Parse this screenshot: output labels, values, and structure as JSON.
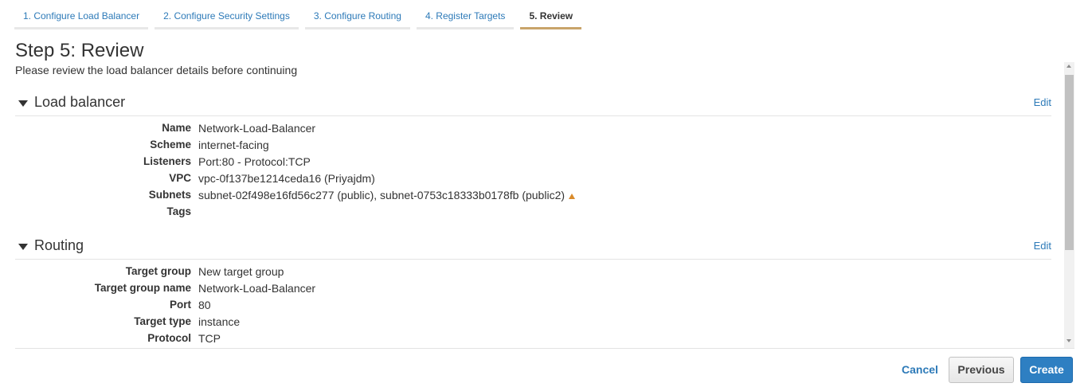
{
  "tabs": [
    {
      "label": "1. Configure Load Balancer",
      "active": false
    },
    {
      "label": "2. Configure Security Settings",
      "active": false
    },
    {
      "label": "3. Configure Routing",
      "active": false
    },
    {
      "label": "4. Register Targets",
      "active": false
    },
    {
      "label": "5. Review",
      "active": true
    }
  ],
  "page": {
    "title": "Step 5: Review",
    "subtitle": "Please review the load balancer details before continuing"
  },
  "sections": {
    "load_balancer": {
      "title": "Load balancer",
      "edit_label": "Edit",
      "rows": [
        {
          "label": "Name",
          "value": "Network-Load-Balancer"
        },
        {
          "label": "Scheme",
          "value": "internet-facing"
        },
        {
          "label": "Listeners",
          "value": "Port:80 - Protocol:TCP"
        },
        {
          "label": "VPC",
          "value": "vpc-0f137be1214ceda16 (Priyajdm)"
        },
        {
          "label": "Subnets",
          "value": "subnet-02f498e16fd56c277 (public), subnet-0753c18333b0178fb (public2)"
        },
        {
          "label": "Tags",
          "value": ""
        }
      ]
    },
    "routing": {
      "title": "Routing",
      "edit_label": "Edit",
      "rows": [
        {
          "label": "Target group",
          "value": "New target group"
        },
        {
          "label": "Target group name",
          "value": "Network-Load-Balancer"
        },
        {
          "label": "Port",
          "value": "80"
        },
        {
          "label": "Target type",
          "value": "instance"
        },
        {
          "label": "Protocol",
          "value": "TCP"
        }
      ]
    }
  },
  "footer": {
    "cancel_label": "Cancel",
    "previous_label": "Previous",
    "create_label": "Create"
  },
  "colors": {
    "link": "#2d7ab8",
    "active_tab_underline": "#c9a46a",
    "primary_button": "#2e7fc2",
    "warning": "#d98b2b"
  },
  "icons": {
    "subnets_warning": "warning-triangle-icon",
    "section_toggle": "caret-down-icon"
  }
}
